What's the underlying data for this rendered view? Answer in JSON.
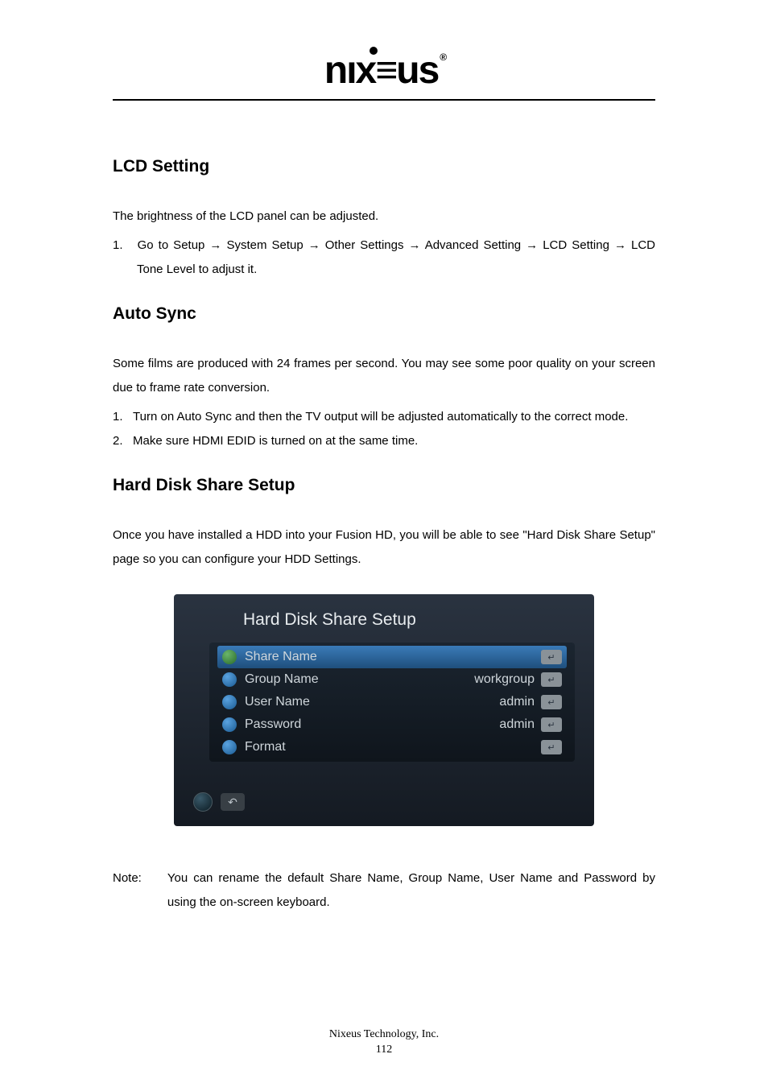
{
  "logo_text": "nıx≡us",
  "sections": {
    "lcd": {
      "heading": "LCD Setting",
      "intro": "The brightness of the LCD panel can be adjusted.",
      "step1_num": "1.",
      "step1": "Go to Setup → System Setup → Other Settings → Advanced Setting → LCD Setting → LCD Tone Level to adjust it."
    },
    "sync": {
      "heading": "Auto Sync",
      "intro": "Some films are produced with 24 frames per second. You may see some poor quality on your screen due to frame rate conversion.",
      "step1_num": "1.",
      "step1": "Turn on Auto Sync and then the TV output will be adjusted automatically to the correct mode.",
      "step2_num": "2.",
      "step2": "Make sure HDMI EDID is turned on at the same time."
    },
    "hdd": {
      "heading": "Hard Disk Share Setup",
      "intro": "Once you have installed a HDD into your Fusion HD, you will be able to see \"Hard Disk Share Setup\" page so you can configure your HDD Settings."
    }
  },
  "screenshot": {
    "title": "Hard Disk Share Setup",
    "rows": [
      {
        "label": "Share Name",
        "value": ""
      },
      {
        "label": "Group Name",
        "value": "workgroup"
      },
      {
        "label": "User Name",
        "value": "admin"
      },
      {
        "label": "Password",
        "value": "admin"
      },
      {
        "label": "Format",
        "value": ""
      }
    ]
  },
  "note": {
    "label": "Note:",
    "body": "You can rename the default Share Name, Group Name, User Name and Password by using the on-screen keyboard."
  },
  "footer": {
    "company": "Nixeus Technology, Inc.",
    "page": "112"
  }
}
